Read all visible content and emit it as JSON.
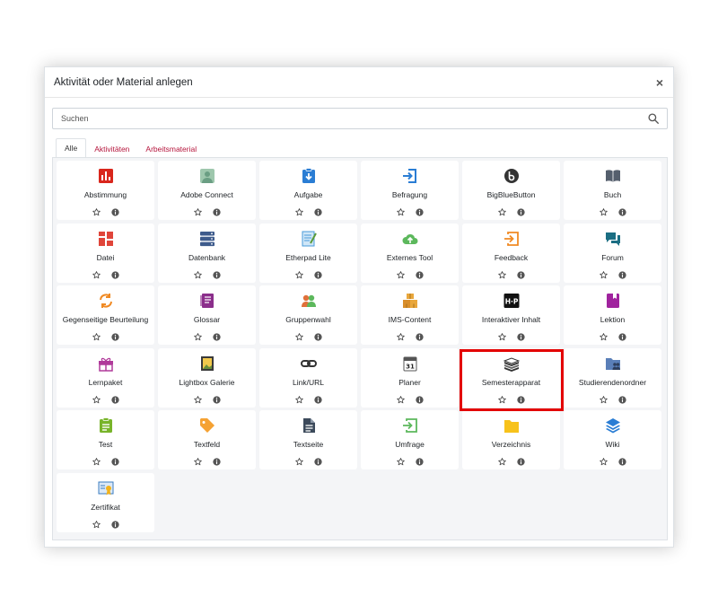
{
  "modal": {
    "title": "Aktivität oder Material anlegen",
    "close_symbol": "×"
  },
  "search": {
    "placeholder": "Suchen"
  },
  "tabs": [
    {
      "label": "Alle",
      "active": true
    },
    {
      "label": "Aktivitäten",
      "active": false
    },
    {
      "label": "Arbeitsmaterial",
      "active": false
    }
  ],
  "colors": {
    "tab_link": "#b5153c",
    "highlight": "#e30000"
  },
  "items": [
    {
      "label": "Abstimmung",
      "icon": "chart-bar-icon",
      "color": "#d9261c"
    },
    {
      "label": "Adobe Connect",
      "icon": "adobe-connect-icon",
      "color": "#6a9e83"
    },
    {
      "label": "Aufgabe",
      "icon": "assignment-icon",
      "color": "#2a7dd4"
    },
    {
      "label": "Befragung",
      "icon": "sign-in-icon",
      "color": "#2a7dd4"
    },
    {
      "label": "BigBlueButton",
      "icon": "bigbluebutton-icon",
      "color": "#333333"
    },
    {
      "label": "Buch",
      "icon": "book-icon",
      "color": "#555f6d"
    },
    {
      "label": "Datei",
      "icon": "file-grid-icon",
      "color": "#e0453a"
    },
    {
      "label": "Datenbank",
      "icon": "database-icon",
      "color": "#3e5b8c"
    },
    {
      "label": "Etherpad Lite",
      "icon": "etherpad-icon",
      "color": "#4a9bd8"
    },
    {
      "label": "Externes Tool",
      "icon": "upload-cloud-icon",
      "color": "#5cb85c"
    },
    {
      "label": "Feedback",
      "icon": "feedback-icon",
      "color": "#f08a24"
    },
    {
      "label": "Forum",
      "icon": "forum-icon",
      "color": "#1b6e83"
    },
    {
      "label": "Gegenseitige Beurteilung",
      "icon": "refresh-icon",
      "color": "#f08a24"
    },
    {
      "label": "Glossar",
      "icon": "glossary-icon",
      "color": "#8b2e8b"
    },
    {
      "label": "Gruppenwahl",
      "icon": "group-icon",
      "color": "#f2a23a"
    },
    {
      "label": "IMS-Content",
      "icon": "package-icon",
      "color": "#e9a73b"
    },
    {
      "label": "Interaktiver Inhalt",
      "icon": "h5p-icon",
      "color": "#111111"
    },
    {
      "label": "Lektion",
      "icon": "lesson-icon",
      "color": "#a0239e"
    },
    {
      "label": "Lernpaket",
      "icon": "gift-icon",
      "color": "#b03a9a"
    },
    {
      "label": "Lightbox Galerie",
      "icon": "gallery-icon",
      "color": "#7a6a4e"
    },
    {
      "label": "Link/URL",
      "icon": "link-icon",
      "color": "#333333"
    },
    {
      "label": "Planer",
      "icon": "calendar-icon",
      "color": "#555555"
    },
    {
      "label": "Semesterapparat",
      "icon": "stack-books-icon",
      "color": "#333333"
    },
    {
      "label": "Studierendenordner",
      "icon": "folder-users-icon",
      "color": "#5a7fb8"
    },
    {
      "label": "Test",
      "icon": "quiz-icon",
      "color": "#78b42a"
    },
    {
      "label": "Textfeld",
      "icon": "tag-icon",
      "color": "#f5a233"
    },
    {
      "label": "Textseite",
      "icon": "page-icon",
      "color": "#3c4a5b"
    },
    {
      "label": "Umfrage",
      "icon": "survey-icon",
      "color": "#5cb85c"
    },
    {
      "label": "Verzeichnis",
      "icon": "folder-icon",
      "color": "#f7c21b"
    },
    {
      "label": "Wiki",
      "icon": "layers-icon",
      "color": "#2a7dd4"
    },
    {
      "label": "Zertifikat",
      "icon": "certificate-icon",
      "color": "#3b7cc2"
    }
  ],
  "highlighted_item": "Semesterapparat"
}
